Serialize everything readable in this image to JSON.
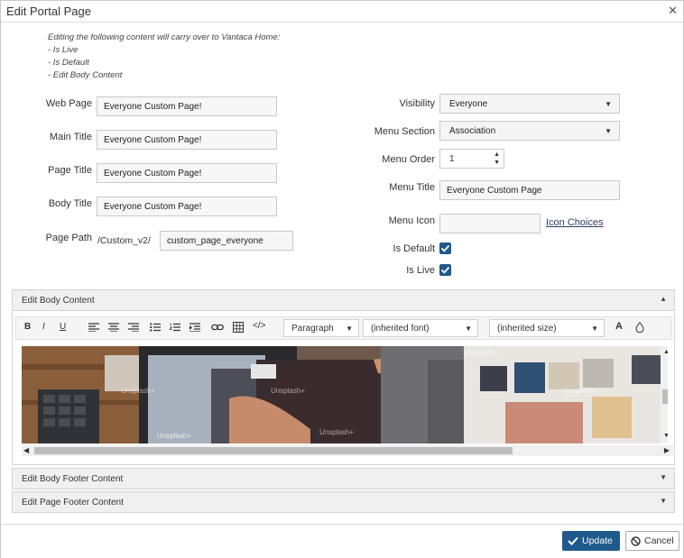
{
  "dialog": {
    "title": "Edit Portal Page"
  },
  "note": {
    "lines": [
      "Editing the following content will carry over to Vantaca Home:",
      "- Is Live",
      "- Is Default",
      "- Edit Body Content"
    ]
  },
  "left": {
    "web_page": {
      "label": "Web Page",
      "value": "Everyone Custom Page!"
    },
    "main_title": {
      "label": "Main Title",
      "value": "Everyone Custom Page!"
    },
    "page_title": {
      "label": "Page Title",
      "value": "Everyone Custom Page!"
    },
    "body_title": {
      "label": "Body Title",
      "value": "Everyone Custom Page!"
    },
    "page_path": {
      "label": "Page Path",
      "prefix": "/Custom_v2/",
      "value": "custom_page_everyone"
    }
  },
  "right": {
    "visibility": {
      "label": "Visibility",
      "value": "Everyone"
    },
    "menu_section": {
      "label": "Menu Section",
      "value": "Association"
    },
    "menu_order": {
      "label": "Menu Order",
      "value": "1"
    },
    "menu_title": {
      "label": "Menu Title",
      "value": "Everyone Custom Page"
    },
    "menu_icon": {
      "label": "Menu Icon",
      "value": "",
      "link": "Icon Choices"
    },
    "is_default": {
      "label": "Is Default",
      "checked": true
    },
    "is_live": {
      "label": "Is Live",
      "checked": true
    }
  },
  "panels": {
    "body": "Edit Body Content",
    "body_footer": "Edit Body Footer Content",
    "page_footer": "Edit Page Footer Content"
  },
  "editor": {
    "toolbar": {
      "bold": "B",
      "italic": "I",
      "underline": "U",
      "format": "Paragraph",
      "font": "(inherited font)",
      "size": "(inherited size)",
      "text_color": "A"
    },
    "image_watermark": "Unsplash+"
  },
  "buttons": {
    "update": "Update",
    "cancel": "Cancel"
  },
  "colors": {
    "primary": "#1f5a8c",
    "link": "#2d3f6b"
  }
}
